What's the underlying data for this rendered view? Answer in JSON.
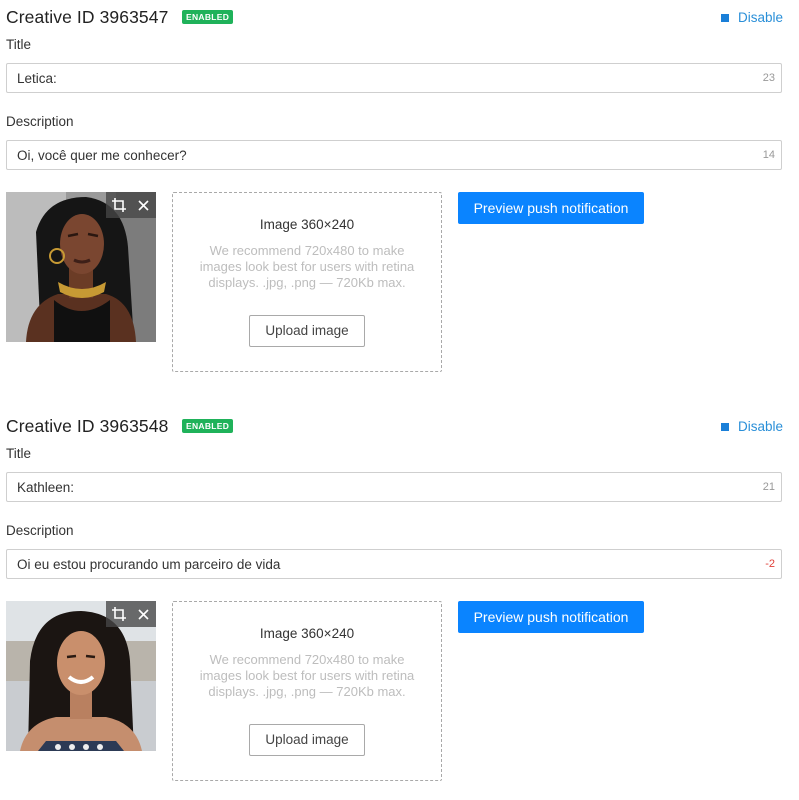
{
  "creatives": [
    {
      "id_text": "Creative ID 3963547",
      "status_badge": "ENABLED",
      "disable_label": "Disable",
      "title_label": "Title",
      "title_value": "Letica:",
      "title_counter": "23",
      "description_label": "Description",
      "description_value": "Oi, você quer me conhecer?",
      "description_counter": "14",
      "image_title": "Image 360×240",
      "image_hint": "We recommend 720x480 to make images look best for users with retina displays. .jpg, .png — 720Kb max.",
      "upload_label": "Upload image",
      "preview_label": "Preview push notification",
      "thumbnail_icon": "woman-photo"
    },
    {
      "id_text": "Creative ID 3963548",
      "status_badge": "ENABLED",
      "disable_label": "Disable",
      "title_label": "Title",
      "title_value": "Kathleen:",
      "title_counter": "21",
      "description_label": "Description",
      "description_value": "Oi eu estou procurando um parceiro de vida",
      "description_counter": "-2",
      "image_title": "Image 360×240",
      "image_hint": "We recommend 720x480 to make images look best for users with retina displays. .jpg, .png — 720Kb max.",
      "upload_label": "Upload image",
      "preview_label": "Preview push notification",
      "thumbnail_icon": "woman-photo"
    }
  ],
  "colors": {
    "badge_green": "#1fb25a",
    "link_blue": "#2a8fd8",
    "primary_button": "#0a84ff",
    "negative_counter": "#e0403a"
  }
}
